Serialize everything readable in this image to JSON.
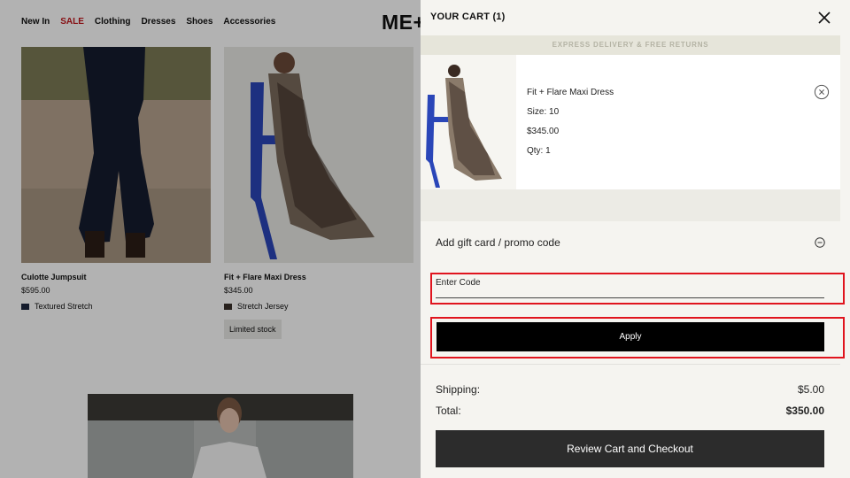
{
  "store": {
    "nav": [
      "New In",
      "SALE",
      "Clothing",
      "Dresses",
      "Shoes",
      "Accessories"
    ],
    "logo": "ME+",
    "products": [
      {
        "name": "Culotte Jumpsuit",
        "price": "$595.00",
        "fabric": "Textured Stretch",
        "swatch": "#1e2740"
      },
      {
        "name": "Fit + Flare Maxi Dress",
        "price": "$345.00",
        "fabric": "Stretch Jersey",
        "swatch": "#3a302a",
        "badge": "Limited stock"
      }
    ]
  },
  "cart": {
    "title": "YOUR CART (1)",
    "banner": "EXPRESS DELIVERY & FREE RETURNS",
    "item": {
      "name": "Fit + Flare Maxi Dress",
      "size": "Size: 10",
      "price": "$345.00",
      "qty": "Qty: 1"
    },
    "promo": {
      "label": "Add gift card / promo code",
      "placeholder": "Enter Code",
      "apply_label": "Apply"
    },
    "summary": {
      "shipping_label": "Shipping:",
      "shipping_value": "$5.00",
      "total_label": "Total:",
      "total_value": "$350.00"
    },
    "checkout_label": "Review Cart and Checkout"
  },
  "colors": {
    "sale": "#c0161c",
    "highlight": "#e0141e",
    "banner_bg": "#e6e5da"
  }
}
